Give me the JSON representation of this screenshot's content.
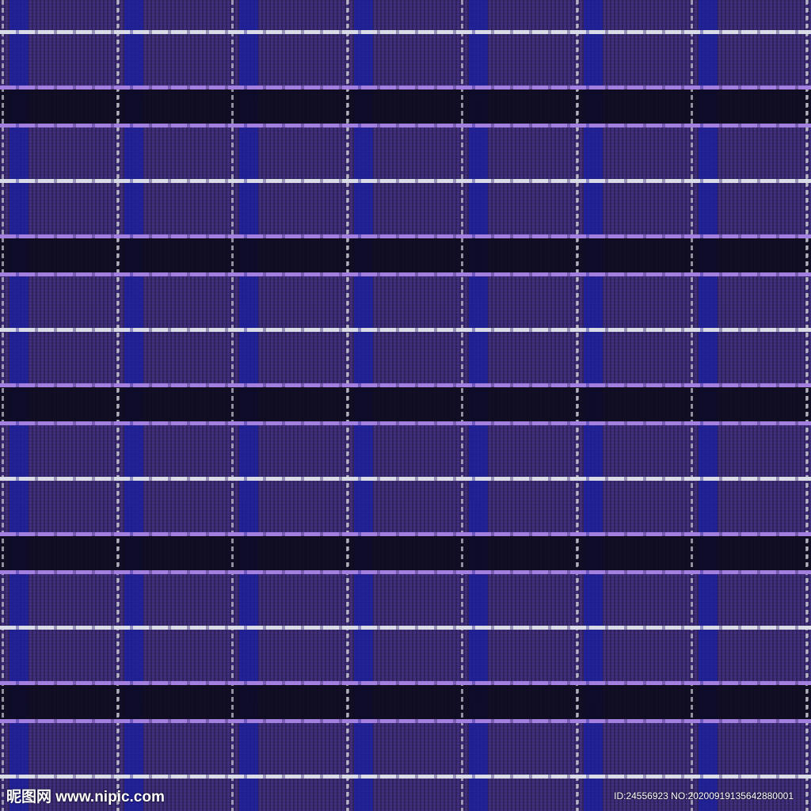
{
  "watermark": {
    "logo": "昵图网 www.nipic.com",
    "id": "ID:24556923 NO:20200919135642880001"
  },
  "colors": {
    "base": "#3b2b72",
    "blue_band": "#191ea0",
    "dark_band": "#0a0816",
    "white_line": "#d9dbe6",
    "lilac_line": "#a37fe0"
  }
}
